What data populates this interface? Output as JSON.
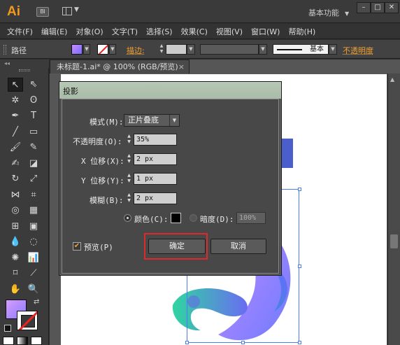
{
  "app": {
    "logo": "Ai",
    "bridge_label": "Bl",
    "workspace": "基本功能"
  },
  "window_buttons": [
    "–",
    "□",
    "✕"
  ],
  "menu": [
    "文件(F)",
    "编辑(E)",
    "对象(O)",
    "文字(T)",
    "选择(S)",
    "效果(C)",
    "视图(V)",
    "窗口(W)",
    "帮助(H)"
  ],
  "control_bar": {
    "object_type": "路径",
    "stroke_label": "描边:",
    "brush": "基本",
    "opacity_label": "不透明度",
    "fill_color": "#a88cff",
    "stroke_color": "none"
  },
  "document_tab": {
    "title": "未标题-1.ai* @ 100% (RGB/预览)",
    "close": "×"
  },
  "tools": {
    "panel_toggle": "◂◂",
    "items": [
      {
        "name": "selection-tool-icon",
        "glyph": "↖",
        "active": true
      },
      {
        "name": "direct-selection-tool-icon",
        "glyph": "⇖"
      },
      {
        "name": "magic-wand-tool-icon",
        "glyph": "✲"
      },
      {
        "name": "lasso-tool-icon",
        "glyph": "ʘ"
      },
      {
        "name": "pen-tool-icon",
        "glyph": "✒"
      },
      {
        "name": "type-tool-icon",
        "glyph": "T"
      },
      {
        "name": "line-tool-icon",
        "glyph": "╱"
      },
      {
        "name": "rectangle-tool-icon",
        "glyph": "▭"
      },
      {
        "name": "paintbrush-tool-icon",
        "glyph": "🖌"
      },
      {
        "name": "pencil-tool-icon",
        "glyph": "✎"
      },
      {
        "name": "blob-brush-tool-icon",
        "glyph": "✍"
      },
      {
        "name": "eraser-tool-icon",
        "glyph": "◪"
      },
      {
        "name": "rotate-tool-icon",
        "glyph": "↻"
      },
      {
        "name": "scale-tool-icon",
        "glyph": "⤢"
      },
      {
        "name": "width-tool-icon",
        "glyph": "⋈"
      },
      {
        "name": "free-transform-tool-icon",
        "glyph": "⌗"
      },
      {
        "name": "shape-builder-tool-icon",
        "glyph": "◎"
      },
      {
        "name": "perspective-grid-tool-icon",
        "glyph": "▦"
      },
      {
        "name": "mesh-tool-icon",
        "glyph": "⊞"
      },
      {
        "name": "gradient-tool-icon",
        "glyph": "▣"
      },
      {
        "name": "eyedropper-tool-icon",
        "glyph": "💧"
      },
      {
        "name": "blend-tool-icon",
        "glyph": "◌"
      },
      {
        "name": "symbol-sprayer-tool-icon",
        "glyph": "✺"
      },
      {
        "name": "column-graph-tool-icon",
        "glyph": "📊"
      },
      {
        "name": "artboard-tool-icon",
        "glyph": "⌑"
      },
      {
        "name": "slice-tool-icon",
        "glyph": "⟋"
      },
      {
        "name": "hand-tool-icon",
        "glyph": "✋"
      },
      {
        "name": "zoom-tool-icon",
        "glyph": "🔍"
      }
    ],
    "swap_glyph": "⇄"
  },
  "dialog": {
    "title": "投影",
    "mode_label": "模式(M):",
    "mode_value": "正片叠底",
    "opacity_label": "不透明度(O):",
    "opacity_value": "35%",
    "x_offset_label": "X 位移(X):",
    "x_offset_value": "2 px",
    "y_offset_label": "Y 位移(Y):",
    "y_offset_value": "1 px",
    "blur_label": "模糊(B):",
    "blur_value": "2 px",
    "color_label": "颜色(C):",
    "darkness_label": "暗度(D):",
    "darkness_value": "100%",
    "preview_label": "预览(P)",
    "preview_checked": true,
    "ok_label": "确定",
    "cancel_label": "取消",
    "shadow_color": "#000000"
  },
  "colors": {
    "accent_orange": "#f2a232",
    "highlight_red": "#e0282c",
    "selection_blue": "#4a7df0"
  }
}
